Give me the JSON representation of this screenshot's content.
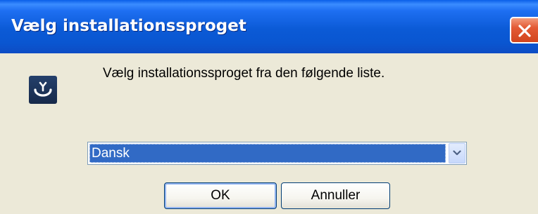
{
  "window": {
    "title": "Vælg installationssproget"
  },
  "dialog": {
    "prompt": "Vælg installationssproget fra den følgende liste.",
    "language_select": {
      "selected_value": "Dansk"
    },
    "buttons": {
      "ok_label": "OK",
      "cancel_label": "Annuller"
    }
  },
  "icons": {
    "title_close": "close-icon",
    "app": "installer-icon",
    "dropdown": "chevron-down-icon"
  },
  "colors": {
    "titlebar_blue": "#0b5ad6",
    "close_red": "#e35a34",
    "dialog_bg": "#ece9d8",
    "selection_blue": "#316ac5",
    "button_border": "#003c74"
  }
}
